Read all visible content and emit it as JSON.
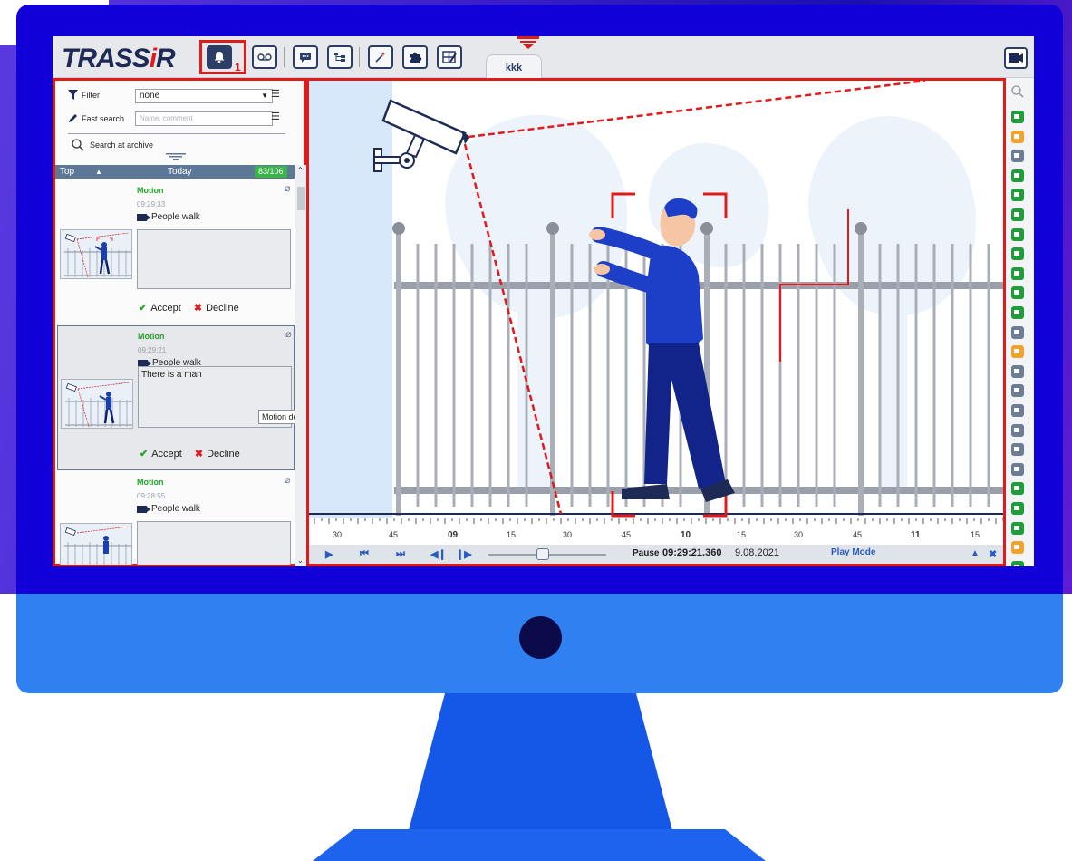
{
  "app": {
    "logo_prefix": "TRASS",
    "logo_i": "i",
    "logo_suffix": "R"
  },
  "toolbar": {
    "badge_number": "1",
    "tab_label": "kkk",
    "icons": [
      "bell-icon",
      "voicemail-icon",
      "chat-icon",
      "tree-icon",
      "magic-wand-icon",
      "puzzle-icon",
      "layout-edit-icon",
      "video-camera-icon"
    ]
  },
  "filters": {
    "filter_label": "Filter",
    "filter_value": "none",
    "fast_search_label": "Fast search",
    "fast_search_placeholder": "Name, comment",
    "search_archive_label": "Search at archive"
  },
  "list_header": {
    "top_label": "Top",
    "today_label": "Today",
    "count": "83/106"
  },
  "events": [
    {
      "type": "Motion",
      "time": "09:29:33",
      "camera": "People walk",
      "comment": "",
      "accept": "Accept",
      "decline": "Decline"
    },
    {
      "type": "Motion",
      "time": "09:29:21",
      "camera": "People walk",
      "comment": "There is a man",
      "accept": "Accept",
      "decline": "Decline"
    },
    {
      "type": "Motion",
      "time": "09:28:55",
      "camera": "People walk",
      "comment": ""
    }
  ],
  "tooltip": "Motion detection",
  "timeline": {
    "labels": [
      "30",
      "45",
      "09",
      "15",
      "30",
      "45",
      "10",
      "15",
      "30",
      "45",
      "11",
      "15"
    ],
    "bold_labels": [
      "09",
      "10",
      "11"
    ]
  },
  "player": {
    "pause_label": "Pause",
    "time": "09:29:21.360",
    "date": "9.08.2021",
    "mode_label": "Play Mode",
    "slider_position": 0.46
  },
  "right_strip": {
    "colors": {
      "green": "#1f9d3a",
      "orange": "#f3a32b",
      "gray": "#6e7d96"
    },
    "items": [
      "green",
      "orange",
      "gray",
      "green",
      "green",
      "green",
      "green",
      "green",
      "green",
      "green",
      "green",
      "gray",
      "orange",
      "gray",
      "gray",
      "gray",
      "gray",
      "gray",
      "gray",
      "green",
      "green",
      "green",
      "orange",
      "green"
    ]
  }
}
